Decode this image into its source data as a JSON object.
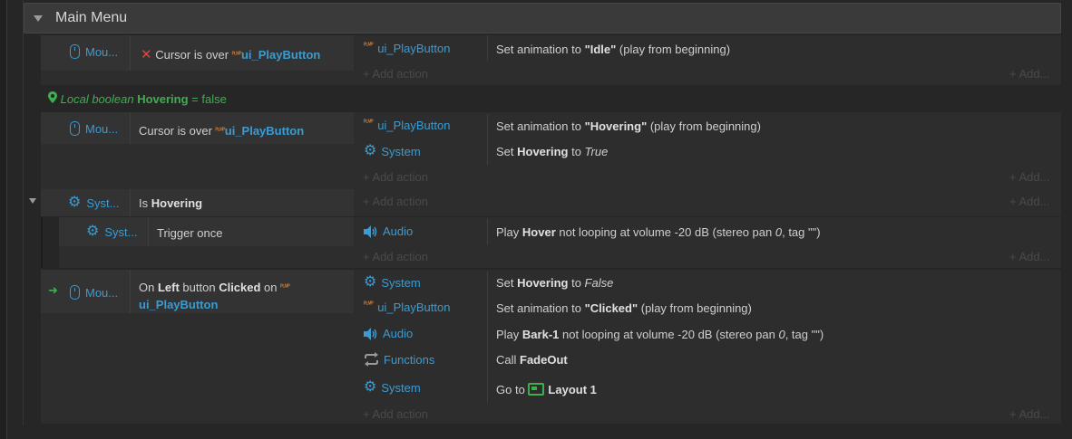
{
  "group": {
    "title": "Main Menu"
  },
  "add_action_label": "+ Add action",
  "add_right_label": "+ Add...",
  "events": {
    "e1": {
      "cond_obj": "Mou...",
      "cond_text": "Cursor is over",
      "cond_target": "ui_PlayButton",
      "actions": [
        {
          "obj": "ui_PlayButton",
          "pre": "Set animation to ",
          "bold": "\"Idle\"",
          "post": " (play from beginning)"
        }
      ]
    },
    "local_var": {
      "prefix": "Local boolean ",
      "name": "Hovering",
      "suffix": " = false"
    },
    "e2": {
      "cond_obj": "Mou...",
      "cond_text": "Cursor is over",
      "cond_target": "ui_PlayButton",
      "actions": [
        {
          "obj": "ui_PlayButton",
          "pre": "Set animation to ",
          "bold": "\"Hovering\"",
          "post": " (play from beginning)"
        },
        {
          "obj": "System",
          "pre": "Set ",
          "bold": "Hovering",
          "mid": " to ",
          "ital": "True"
        }
      ]
    },
    "e3": {
      "cond_obj": "Syst...",
      "cond_pre": "Is ",
      "cond_bold": "Hovering"
    },
    "e3sub": {
      "cond_obj": "Syst...",
      "cond_text": "Trigger once",
      "actions": [
        {
          "obj": "Audio",
          "pre": "Play ",
          "bold": "Hover",
          "mid": " not looping at volume -20 dB (stereo pan ",
          "ital": "0",
          "post": ", tag \"\")"
        }
      ]
    },
    "e4": {
      "cond_obj": "Mou...",
      "cond_pre": "On ",
      "cond_bold1": "Left",
      "cond_mid": " button ",
      "cond_bold2": "Clicked",
      "cond_on": " on",
      "cond_target": "ui_PlayButton",
      "actions": [
        {
          "obj": "System",
          "pre": "Set ",
          "bold": "Hovering",
          "mid": " to ",
          "ital": "False"
        },
        {
          "obj": "ui_PlayButton",
          "pre": "Set animation to ",
          "bold": "\"Clicked\"",
          "post": " (play from beginning)"
        },
        {
          "obj": "Audio",
          "pre": "Play ",
          "bold": "Bark-1",
          "mid": " not looping at volume -20 dB (stereo pan ",
          "ital": "0",
          "post": ", tag \"\")"
        },
        {
          "obj": "Functions",
          "pre": "Call ",
          "bold": "FadeOut"
        },
        {
          "obj": "System",
          "pre": "Go to ",
          "bold": "Layout 1"
        }
      ]
    }
  },
  "icons": {
    "group_toggle": "triangle-down-icon",
    "mouse": "mouse-icon",
    "system": "gear-icon",
    "sprite": "sprite-icon",
    "audio": "speaker-icon",
    "functions": "cycle-arrows-icon",
    "layout": "layout-icon",
    "local_var": "location-pin-icon",
    "invert": "x-icon",
    "trigger": "green-arrow-icon"
  },
  "colors": {
    "object_blue": "#3c9bd0",
    "local_green": "#3fae4f",
    "invert_red": "#d24a4a",
    "sprite_orange": "#c87a3a"
  }
}
